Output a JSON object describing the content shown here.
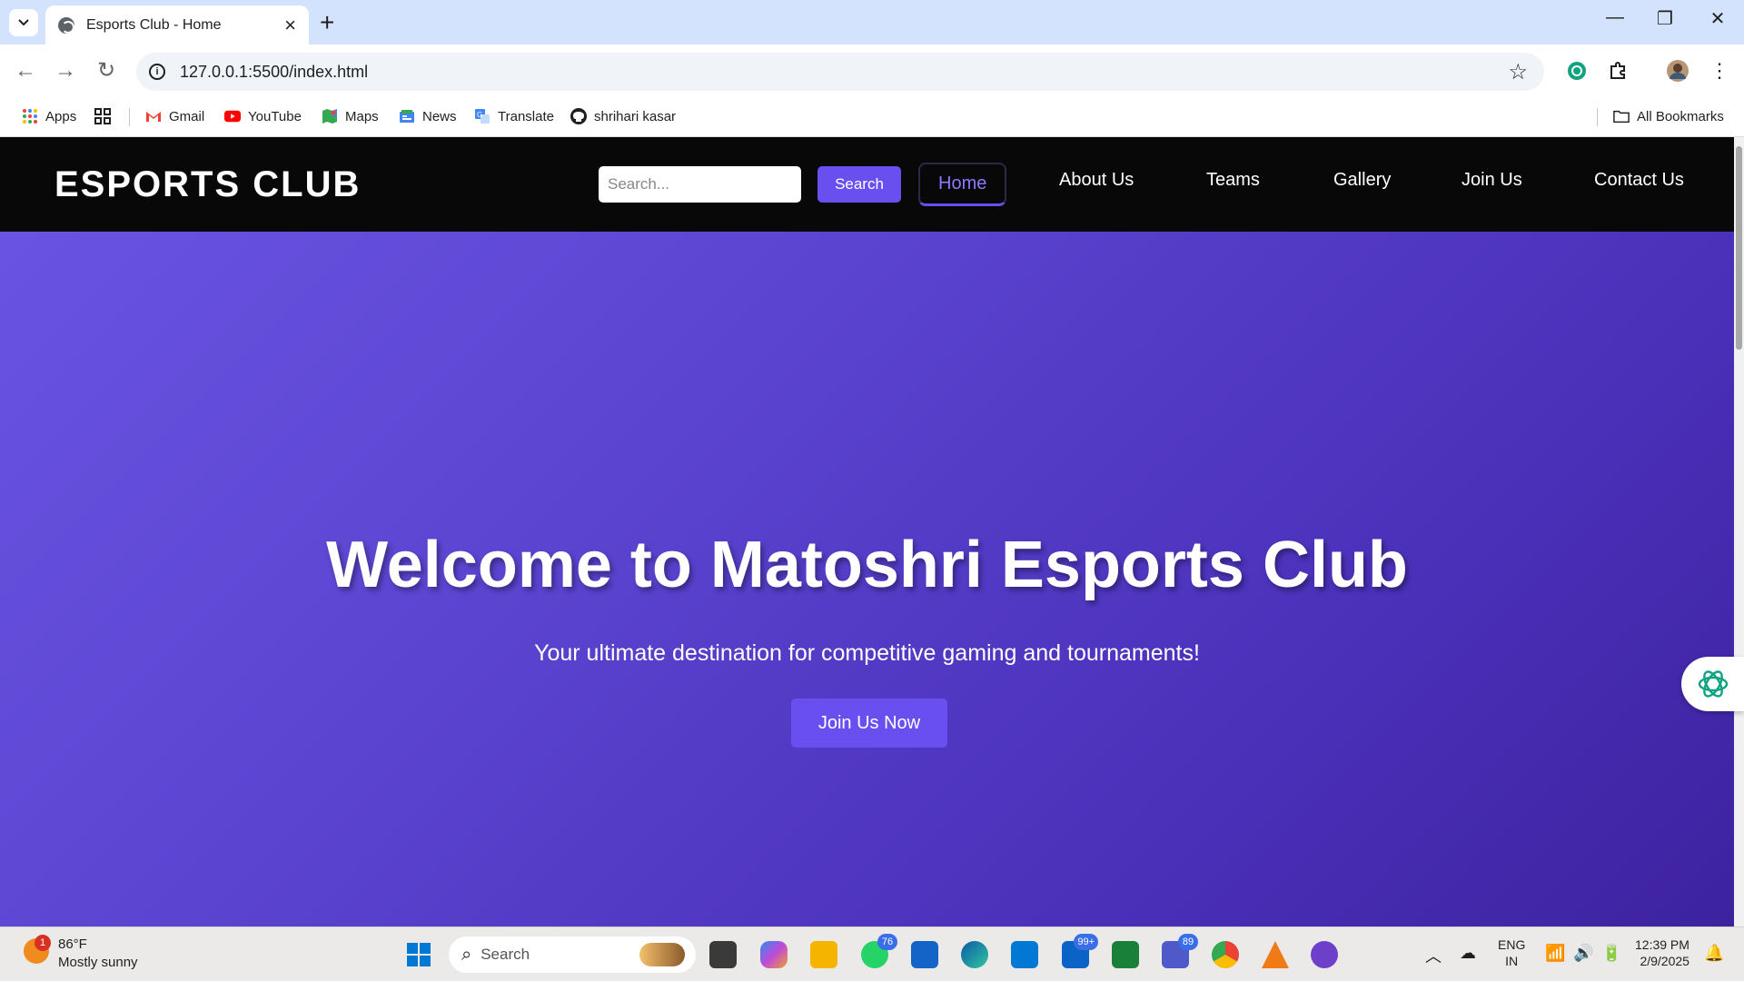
{
  "browser": {
    "tab_title": "Esports Club - Home",
    "url": "127.0.0.1:5500/index.html",
    "bookmarks": [
      {
        "label": "Apps",
        "icon": "apps-grid-icon"
      },
      {
        "label": "",
        "icon": "tab-groups-icon"
      },
      {
        "label": "Gmail",
        "icon": "gmail-icon"
      },
      {
        "label": "YouTube",
        "icon": "youtube-icon"
      },
      {
        "label": "Maps",
        "icon": "maps-icon"
      },
      {
        "label": "News",
        "icon": "news-icon"
      },
      {
        "label": "Translate",
        "icon": "translate-icon"
      },
      {
        "label": "shrihari kasar",
        "icon": "github-icon"
      }
    ],
    "all_bookmarks": "All Bookmarks"
  },
  "site": {
    "logo": "ESPORTS CLUB",
    "search_placeholder": "Search...",
    "search_button": "Search",
    "nav": [
      "Home",
      "About Us",
      "Teams",
      "Gallery",
      "Join Us",
      "Contact Us"
    ],
    "active_nav": "Home",
    "accent_color": "#6a4ff0"
  },
  "hero": {
    "title": "Welcome to Matoshri Esports Club",
    "subtitle": "Your ultimate destination for competitive gaming and tournaments!",
    "cta": "Join Us Now"
  },
  "taskbar": {
    "weather_temp": "86°F",
    "weather_condition": "Mostly sunny",
    "weather_badge": "1",
    "search_label": "Search",
    "badges": {
      "whatsapp": "76",
      "outlook": "99+",
      "teams": "89"
    },
    "lang_top": "ENG",
    "lang_bottom": "IN",
    "time": "12:39 PM",
    "date": "2/9/2025"
  }
}
